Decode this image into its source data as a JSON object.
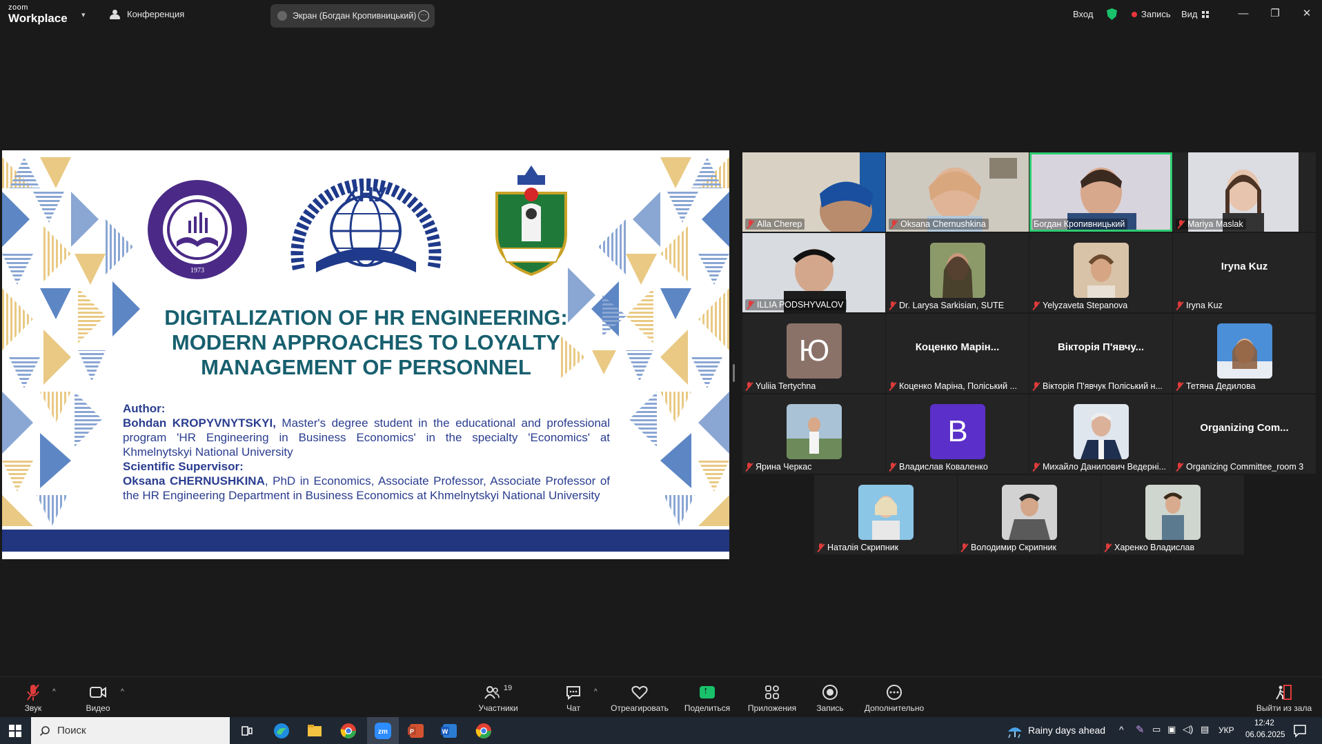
{
  "titlebar": {
    "brand_small": "zoom",
    "brand_large": "Workplace",
    "meeting_label": "Конференция",
    "screen_share_label": "Экран (Богдан Кропивницький)",
    "signin": "Вход",
    "record": "Запись",
    "view": "Вид"
  },
  "slide": {
    "title_lines": [
      "DIGITALIZATION OF HR ENGINEERING:",
      "MODERN APPROACHES TO LOYALTY",
      "MANAGEMENT OF PERSONNEL"
    ],
    "author_heading": "Author:",
    "author_name": "Bohdan KROPYVNYTSKYI,",
    "author_desc": " Master's degree student in the educational and professional program 'HR Engineering in Business Economics' in the specialty 'Economics' at Khmelnytskyi National University",
    "supervisor_heading": "Scientific Supervisor:",
    "supervisor_name": "Oksana CHERNUSHKINA",
    "supervisor_desc": ", PhD in Economics, Associate Professor, Associate Professor of the HR Engineering Department in Business Economics at Khmelnytskyi National University",
    "logo_left_year": "1973",
    "logo_center_abbr": "ХНУ"
  },
  "participants": [
    {
      "name": "Alla Cherep"
    },
    {
      "name": "Oksana Chernushkina"
    },
    {
      "name": "Богдан Кропивницький"
    },
    {
      "name": "Mariya Maslak"
    },
    {
      "name": "ILLIA PODSHYVALOV"
    },
    {
      "name": "Dr. Larysa Sarkisian, SUTE"
    },
    {
      "name": "Yelyzaveta Stepanova"
    },
    {
      "name": "Iryna Kuz",
      "big": "Iryna Kuz"
    },
    {
      "name": "Yuliia Tertychna",
      "letter": "Ю"
    },
    {
      "name": "Коценко Маріна, Поліський ...",
      "big": "Коценко Марін..."
    },
    {
      "name": "Вікторія П'явчук Поліський н...",
      "big": "Вікторія П'явчу..."
    },
    {
      "name": "Тетяна Дедилова"
    },
    {
      "name": "Ярина Черкас"
    },
    {
      "name": "Владислав Коваленко",
      "letter": "B"
    },
    {
      "name": "Михайло Данилович Ведерні..."
    },
    {
      "name": "Organizing Committee_room 3",
      "big": "Organizing Com..."
    },
    {
      "name": "Наталія Скрипник"
    },
    {
      "name": "Володимир Скрипник"
    },
    {
      "name": "Харенко Владислав"
    }
  ],
  "toolbar": {
    "audio": "Звук",
    "video": "Видео",
    "participants": "Участники",
    "participants_count": "19",
    "chat": "Чат",
    "react": "Отреагировать",
    "share": "Поделиться",
    "apps": "Приложения",
    "record": "Запись",
    "more": "Дополнительно",
    "leave": "Выйти из зала"
  },
  "taskbar": {
    "search_placeholder": "Поиск",
    "weather": "Rainy days ahead",
    "lang": "УКР",
    "time": "12:42",
    "date": "06.06.2025"
  },
  "colors": {
    "slide_title": "#175f6e",
    "slide_text": "#2a3d8f",
    "slide_bar": "#22367f",
    "active_speaker": "#2ecc71",
    "muted": "#e03b3b"
  }
}
